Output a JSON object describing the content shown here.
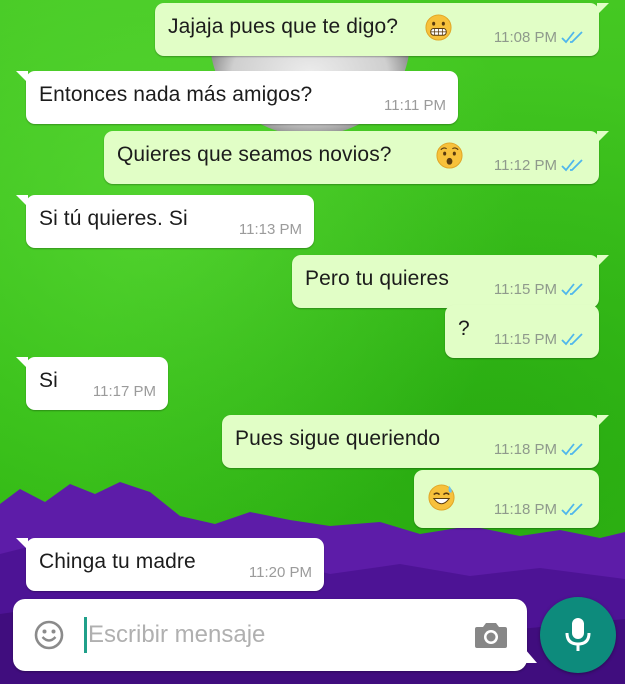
{
  "messages": [
    {
      "direction": "out",
      "text": "Jajaja pues que te digo?",
      "emoji": "grimacing-face",
      "time": "11:08 PM",
      "read": true
    },
    {
      "direction": "in",
      "text": "Entonces nada más amigos?",
      "time": "11:11 PM"
    },
    {
      "direction": "out",
      "text": "Quieres que seamos novios?",
      "emoji": "hushed-face",
      "time": "11:12 PM",
      "read": true
    },
    {
      "direction": "in",
      "text": "Si tú quieres. Si",
      "time": "11:13 PM"
    },
    {
      "direction": "out",
      "text": "Pero tu quieres",
      "time": "11:15 PM",
      "read": true
    },
    {
      "direction": "out",
      "text": "?",
      "time": "11:15 PM",
      "read": true
    },
    {
      "direction": "in",
      "text": "Si",
      "time": "11:17 PM"
    },
    {
      "direction": "out",
      "text": "Pues sigue queriendo",
      "time": "11:18 PM",
      "read": true
    },
    {
      "direction": "out",
      "text": "",
      "emoji": "grinning-sweat-face",
      "time": "11:18 PM",
      "read": true
    },
    {
      "direction": "in",
      "text": "Chinga tu madre",
      "time": "11:20 PM"
    }
  ],
  "composer": {
    "placeholder": "Escribir mensaje",
    "emoji_icon": "smiley-icon",
    "camera_icon": "camera-icon",
    "send_icon": "microphone-icon"
  },
  "colors": {
    "wallpaper_green": "#3fc41b",
    "wallpaper_purple": "#5b1aa8",
    "outgoing_bubble": "#e1fec6",
    "incoming_bubble": "#ffffff",
    "read_ticks": "#4fb6ec",
    "mic_button": "#0d8b7c"
  }
}
